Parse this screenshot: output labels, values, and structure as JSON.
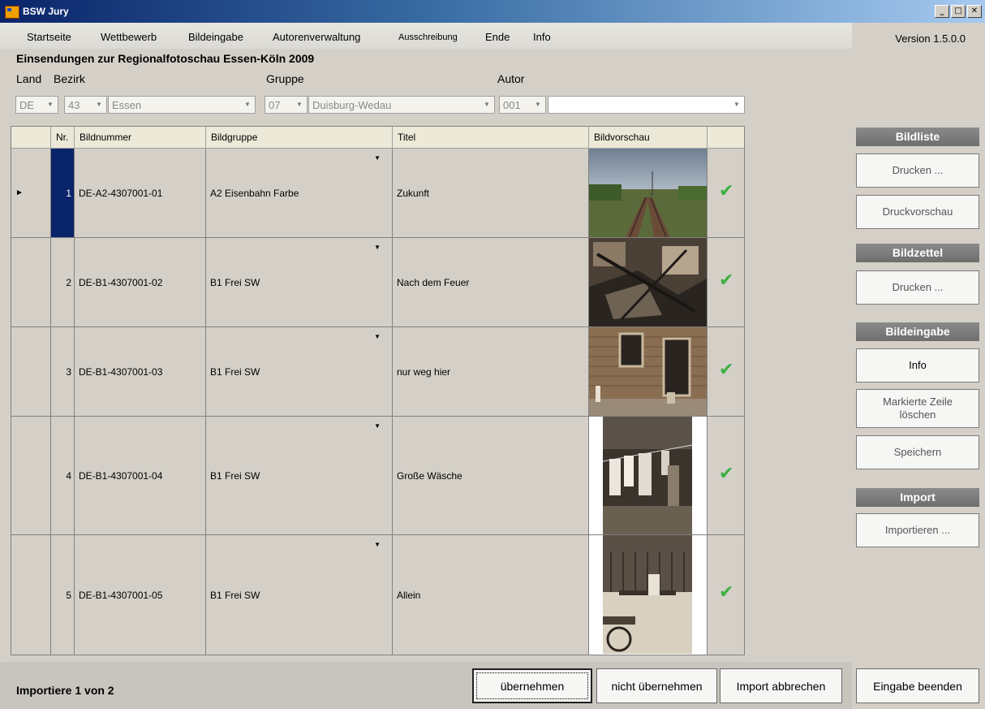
{
  "window": {
    "title": "BSW Jury",
    "minimize": "_",
    "maximize": "□",
    "close": "✕"
  },
  "menu": [
    "Startseite",
    "Wettbewerb",
    "Bildeingabe",
    "Autorenverwaltung",
    "Ausschreibung",
    "Ende",
    "Info"
  ],
  "version": "Version 1.5.0.0",
  "heading": "Einsendungen zur Regionalfotoschau Essen-Köln 2009",
  "filters": {
    "labels": {
      "land": "Land",
      "bezirk": "Bezirk",
      "gruppe": "Gruppe",
      "autor": "Autor"
    },
    "land": "DE",
    "bezirk_code": "43",
    "bezirk_name": "Essen",
    "gruppe_code": "07",
    "gruppe_name": "Duisburg-Wedau",
    "autor_code": "001",
    "autor_name": ""
  },
  "grid": {
    "columns": [
      "",
      "Nr.",
      "Bildnummer",
      "Bildgruppe",
      "Titel",
      "Bildvorschau",
      ""
    ],
    "rows": [
      {
        "nr": "1",
        "bildnummer": "DE-A2-4307001-01",
        "bildgruppe": "A2 Eisenbahn Farbe",
        "titel": "Zukunft",
        "preview": "railway-tracks-photo",
        "ok": "✔"
      },
      {
        "nr": "2",
        "bildnummer": "DE-B1-4307001-02",
        "bildgruppe": "B1 Frei SW",
        "titel": "Nach dem Feuer",
        "preview": "burnt-room-photo",
        "ok": "✔"
      },
      {
        "nr": "3",
        "bildnummer": "DE-B1-4307001-03",
        "bildgruppe": "B1 Frei SW",
        "titel": "nur weg hier",
        "preview": "brick-house-photo",
        "ok": "✔"
      },
      {
        "nr": "4",
        "bildnummer": "DE-B1-4307001-04",
        "bildgruppe": "B1 Frei SW",
        "titel": "Große Wäsche",
        "preview": "laundry-line-photo",
        "ok": "✔"
      },
      {
        "nr": "5",
        "bildnummer": "DE-B1-4307001-05",
        "bildgruppe": "B1 Frei SW",
        "titel": "Allein",
        "preview": "old-woman-bench-photo",
        "ok": "✔"
      }
    ],
    "current_row_marker": "►"
  },
  "sidebar": {
    "bildliste": {
      "title": "Bildliste",
      "print": "Drucken ...",
      "preview": "Druckvorschau"
    },
    "bildzettel": {
      "title": "Bildzettel",
      "print": "Drucken ..."
    },
    "bildeingabe": {
      "title": "Bildeingabe",
      "info": "Info",
      "delete": "Markierte Zeile löschen",
      "save": "Speichern"
    },
    "import": {
      "title": "Import",
      "import": "Importieren ..."
    }
  },
  "footer": {
    "status": "Importiere 1 von 2",
    "accept": "übernehmen",
    "reject": "nicht übernehmen",
    "abort": "Import abbrechen",
    "finish": "Eingabe beenden"
  }
}
